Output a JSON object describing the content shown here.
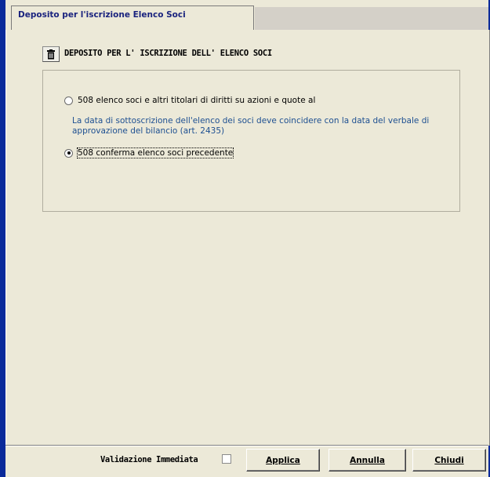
{
  "tab": {
    "label": "Deposito per l'iscrizione Elenco Soci"
  },
  "header": {
    "title": "DEPOSITO PER L' ISCRIZIONE DELL' ELENCO SOCI",
    "icon": "trash-icon"
  },
  "options": [
    {
      "label": "508 elenco soci e altri titolari di diritti su azioni e quote al",
      "checked": false
    },
    {
      "label": "508 conferma elenco soci precedente",
      "checked": true
    }
  ],
  "info_text": "La data di sottoscrizione dell'elenco dei soci deve coincidere con la data del verbale di approvazione del bilancio (art. 2435)",
  "footer": {
    "validation_label": "Validazione Immediata",
    "validation_checked": false,
    "apply_label": "Applica",
    "cancel_label": "Annulla",
    "close_label": "Chiudi"
  },
  "colors": {
    "window_border": "#0a2a9a",
    "info_text": "#1d4f91",
    "tab_label": "#1a237e"
  }
}
